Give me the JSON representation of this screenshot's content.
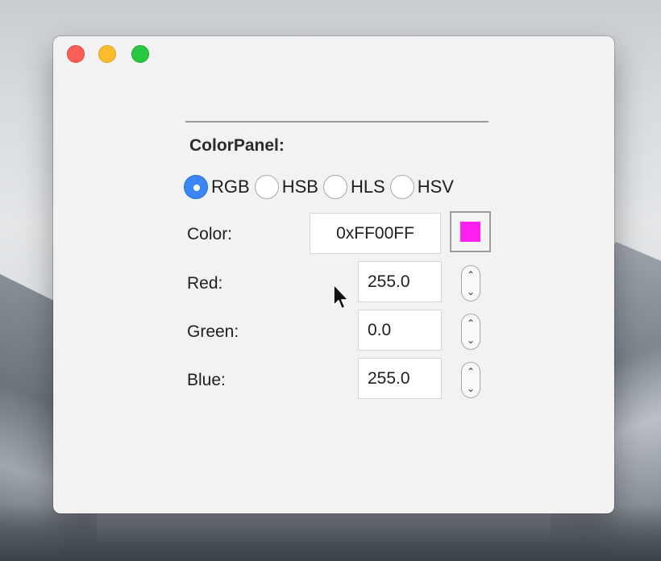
{
  "window": {
    "controls": [
      "close",
      "minimize",
      "zoom"
    ]
  },
  "panel": {
    "title": "ColorPanel:",
    "color_models": [
      {
        "label": "RGB",
        "selected": true
      },
      {
        "label": "HSB",
        "selected": false
      },
      {
        "label": "HLS",
        "selected": false
      },
      {
        "label": "HSV",
        "selected": false
      }
    ],
    "color": {
      "label": "Color:",
      "hex_value": "0xFF00FF",
      "swatch_color": "#ff1ff0"
    },
    "channels": [
      {
        "label": "Red:",
        "value": "255.0"
      },
      {
        "label": "Green:",
        "value": "0.0"
      },
      {
        "label": "Blue:",
        "value": "255.0"
      }
    ]
  },
  "icons": {
    "stepper_up": "chevron-up-icon",
    "stepper_down": "chevron-down-icon",
    "cursor": "arrow-cursor-icon"
  },
  "colors": {
    "accent": "#3a86f5",
    "close": "#fc5f57",
    "minimize": "#fdbc2e",
    "zoom": "#28c840"
  }
}
